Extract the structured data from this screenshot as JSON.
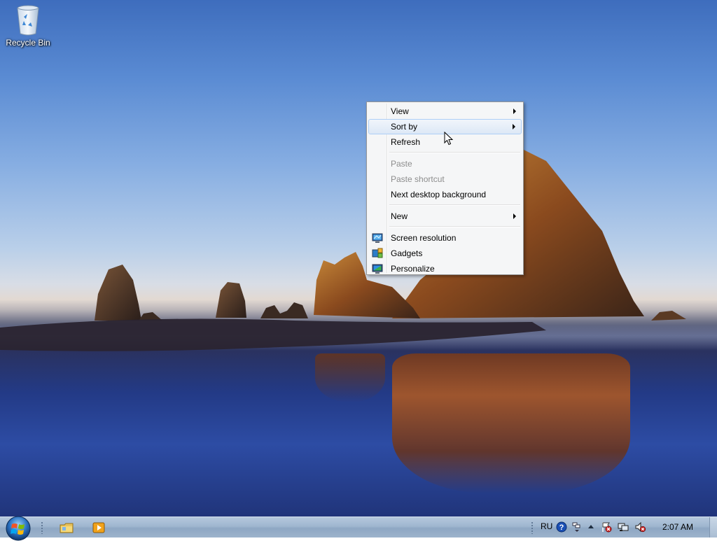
{
  "desktop": {
    "icons": [
      {
        "label": "Recycle Bin",
        "icon": "recycle-bin-icon"
      }
    ]
  },
  "context_menu": {
    "items": [
      {
        "label": "View",
        "submenu": true,
        "enabled": true
      },
      {
        "label": "Sort by",
        "submenu": true,
        "enabled": true,
        "highlighted": true
      },
      {
        "label": "Refresh",
        "submenu": false,
        "enabled": true
      },
      {
        "label": "Paste",
        "submenu": false,
        "enabled": false
      },
      {
        "label": "Paste shortcut",
        "submenu": false,
        "enabled": false
      },
      {
        "label": "Next desktop background",
        "submenu": false,
        "enabled": true
      },
      {
        "label": "New",
        "submenu": true,
        "enabled": true
      },
      {
        "label": "Screen resolution",
        "icon": "screen-resolution-icon",
        "enabled": true
      },
      {
        "label": "Gadgets",
        "icon": "gadgets-icon",
        "enabled": true
      },
      {
        "label": "Personalize",
        "icon": "personalize-icon",
        "enabled": true
      }
    ]
  },
  "taskbar": {
    "start_icon": "windows-orb-icon",
    "pinned": [
      {
        "icon": "windows-explorer-icon"
      },
      {
        "icon": "media-player-icon"
      }
    ],
    "tray": {
      "language": "RU",
      "icons": [
        "help-icon",
        "network-small-icon",
        "show-hidden-icons-arrow",
        "action-center-flag-icon",
        "network-icon",
        "volume-muted-icon"
      ],
      "clock": "2:07 AM"
    }
  },
  "colors": {
    "menu_background": "#f5f6f7",
    "menu_hover": "#dde8f6",
    "disabled_text": "#8d8d8d",
    "taskbar": "#9fb6cf"
  }
}
